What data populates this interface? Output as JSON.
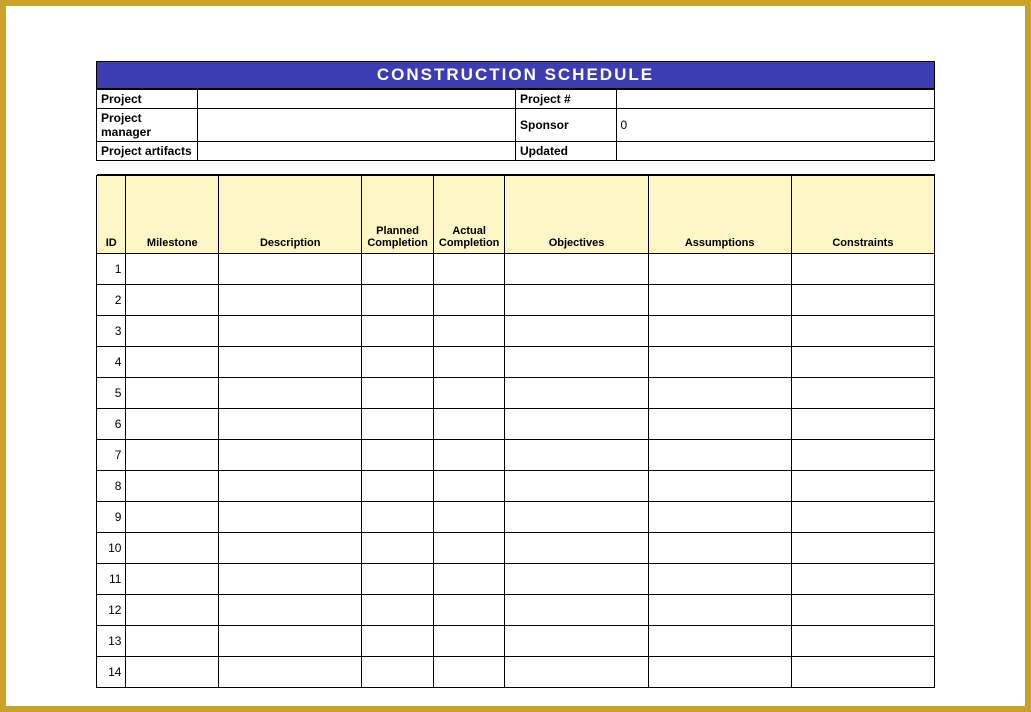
{
  "title": "CONSTRUCTION SCHEDULE",
  "meta": {
    "row1": {
      "label1": "Project",
      "value1": "",
      "label2": "Project #",
      "value2": ""
    },
    "row2": {
      "label1": "Project manager",
      "value1": "",
      "label2": "Sponsor",
      "value2": "0"
    },
    "row3": {
      "label1": "Project artifacts",
      "value1": "",
      "label2": "Updated",
      "value2": ""
    }
  },
  "columns": {
    "id": "ID",
    "milestone": "Milestone",
    "description": "Description",
    "planned": "Planned Completion",
    "actual": "Actual Completion",
    "objectives": "Objectives",
    "assumptions": "Assumptions",
    "constraints": "Constraints"
  },
  "rows": [
    {
      "id": "1",
      "milestone": "",
      "description": "",
      "planned": "",
      "actual": "",
      "objectives": "",
      "assumptions": "",
      "constraints": ""
    },
    {
      "id": "2",
      "milestone": "",
      "description": "",
      "planned": "",
      "actual": "",
      "objectives": "",
      "assumptions": "",
      "constraints": ""
    },
    {
      "id": "3",
      "milestone": "",
      "description": "",
      "planned": "",
      "actual": "",
      "objectives": "",
      "assumptions": "",
      "constraints": ""
    },
    {
      "id": "4",
      "milestone": "",
      "description": "",
      "planned": "",
      "actual": "",
      "objectives": "",
      "assumptions": "",
      "constraints": ""
    },
    {
      "id": "5",
      "milestone": "",
      "description": "",
      "planned": "",
      "actual": "",
      "objectives": "",
      "assumptions": "",
      "constraints": ""
    },
    {
      "id": "6",
      "milestone": "",
      "description": "",
      "planned": "",
      "actual": "",
      "objectives": "",
      "assumptions": "",
      "constraints": ""
    },
    {
      "id": "7",
      "milestone": "",
      "description": "",
      "planned": "",
      "actual": "",
      "objectives": "",
      "assumptions": "",
      "constraints": ""
    },
    {
      "id": "8",
      "milestone": "",
      "description": "",
      "planned": "",
      "actual": "",
      "objectives": "",
      "assumptions": "",
      "constraints": ""
    },
    {
      "id": "9",
      "milestone": "",
      "description": "",
      "planned": "",
      "actual": "",
      "objectives": "",
      "assumptions": "",
      "constraints": ""
    },
    {
      "id": "10",
      "milestone": "",
      "description": "",
      "planned": "",
      "actual": "",
      "objectives": "",
      "assumptions": "",
      "constraints": ""
    },
    {
      "id": "11",
      "milestone": "",
      "description": "",
      "planned": "",
      "actual": "",
      "objectives": "",
      "assumptions": "",
      "constraints": ""
    },
    {
      "id": "12",
      "milestone": "",
      "description": "",
      "planned": "",
      "actual": "",
      "objectives": "",
      "assumptions": "",
      "constraints": ""
    },
    {
      "id": "13",
      "milestone": "",
      "description": "",
      "planned": "",
      "actual": "",
      "objectives": "",
      "assumptions": "",
      "constraints": ""
    },
    {
      "id": "14",
      "milestone": "",
      "description": "",
      "planned": "",
      "actual": "",
      "objectives": "",
      "assumptions": "",
      "constraints": ""
    }
  ]
}
